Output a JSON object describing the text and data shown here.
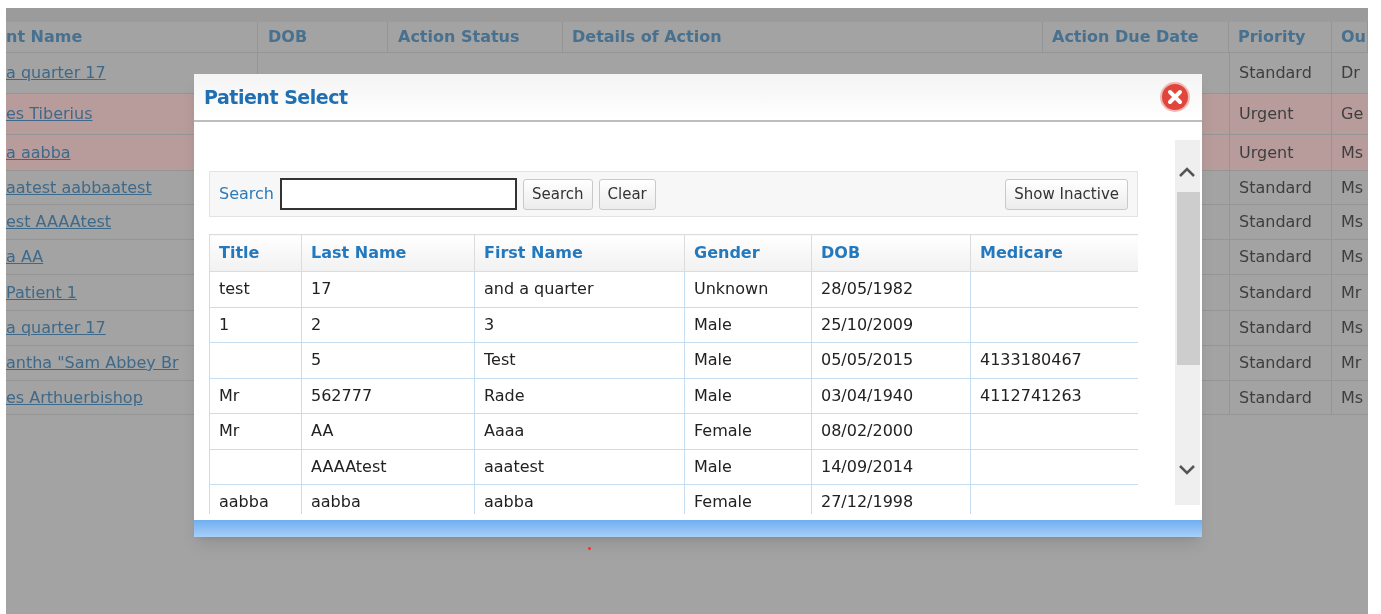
{
  "background_table": {
    "columns": [
      "nt Name",
      "DOB",
      "Action Status",
      "Details of Action",
      "Action Due Date",
      "Priority",
      "Ou"
    ],
    "rows": [
      {
        "name": "a quarter 17",
        "priority": "Standard",
        "column_7": "Dr",
        "highlighted": false
      },
      {
        "name": "es Tiberius",
        "priority": "Urgent",
        "column_7": "Ge",
        "highlighted": true
      },
      {
        "name": "a aabba",
        "priority": "Urgent",
        "column_7": "Ms",
        "highlighted": true
      },
      {
        "name": "aatest aabbaatest",
        "priority": "Standard",
        "column_7": "Ms",
        "highlighted": false
      },
      {
        "name": "est AAAAtest",
        "priority": "Standard",
        "column_7": "Ms",
        "highlighted": false
      },
      {
        "name": "a AA",
        "priority": "Standard",
        "column_7": "Ms",
        "highlighted": false
      },
      {
        "name": "Patient 1",
        "priority": "Standard",
        "column_7": "Mr",
        "highlighted": false
      },
      {
        "name": "a quarter 17",
        "priority": "Standard",
        "column_7": "Ms",
        "highlighted": false
      },
      {
        "name": "antha \"Sam Abbey Br",
        "priority": "Standard",
        "column_7": "Mr",
        "highlighted": false
      },
      {
        "name": "es Arthuerbishop",
        "priority": "Standard",
        "column_7": "Ms",
        "highlighted": false
      }
    ]
  },
  "dialog": {
    "title": "Patient Select",
    "search": {
      "label": "Search",
      "buttons": [
        "Search",
        "Clear"
      ],
      "show_inactive": "Show Inactive"
    },
    "table": {
      "columns": [
        "Title",
        "Last Name",
        "First Name",
        "Gender",
        "DOB",
        "Medicare"
      ],
      "rows": [
        [
          "test",
          "17",
          "and a quarter",
          "Unknown",
          "28/05/1982",
          ""
        ],
        [
          "1",
          "2",
          "3",
          "Male",
          "25/10/2009",
          ""
        ],
        [
          "",
          "5",
          "Test",
          "Male",
          "05/05/2015",
          "4133180467"
        ],
        [
          "Mr",
          "562777",
          "Rade",
          "Male",
          "03/04/1940",
          "4112741263"
        ],
        [
          "Mr",
          "AA",
          "Aaaa",
          "Female",
          "08/02/2000",
          ""
        ],
        [
          "",
          "AAAAtest",
          "aaatest",
          "Male",
          "14/09/2014",
          ""
        ],
        [
          "aabba",
          "aabba",
          "aabba",
          "Female",
          "27/12/1998",
          ""
        ]
      ]
    }
  }
}
